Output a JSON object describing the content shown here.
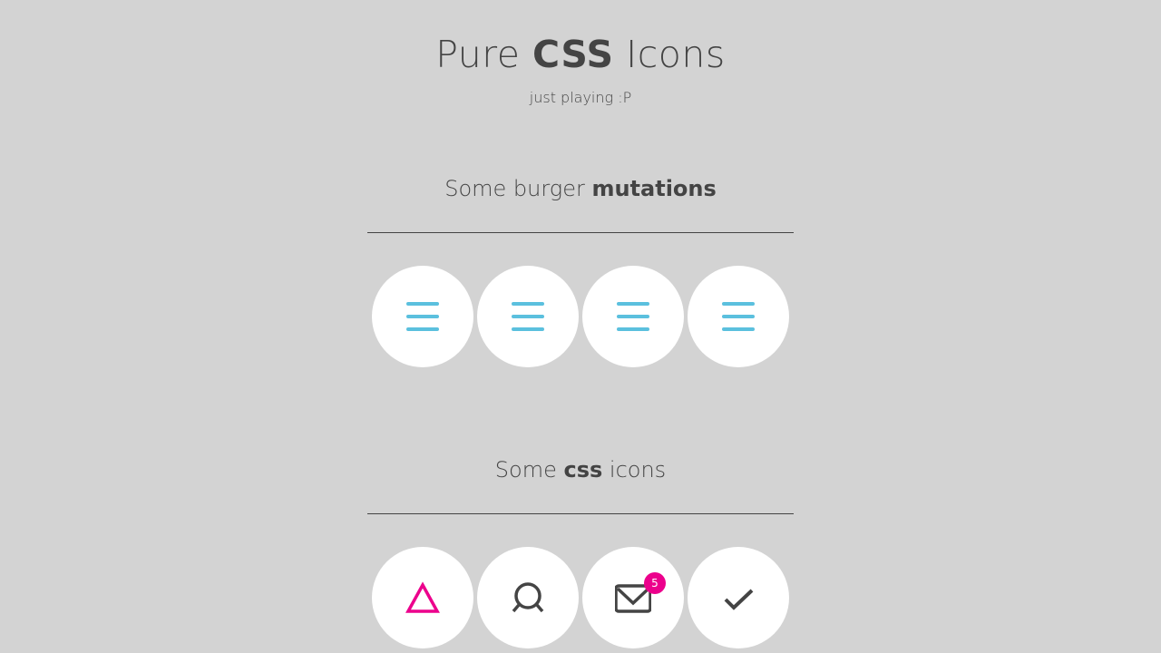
{
  "header": {
    "title_prefix": "Pure ",
    "title_bold": "CSS",
    "title_suffix": " Icons",
    "subtitle": "just playing :P"
  },
  "sections": [
    {
      "title_prefix": "Some burger ",
      "title_bold": "mutations",
      "title_suffix": "",
      "icons": [
        "burger-icon",
        "burger-icon",
        "burger-icon",
        "burger-icon"
      ],
      "icon_color": "#5bc0de"
    },
    {
      "title_prefix": "Some ",
      "title_bold": "css",
      "title_suffix": " icons",
      "icons": [
        "triangle-icon",
        "search-icon",
        "mail-icon",
        "check-icon"
      ],
      "mail_badge_count": "5",
      "accent_color": "#ec008c",
      "icon_color": "#444444"
    }
  ],
  "colors": {
    "background": "#d3d3d3",
    "circle": "#ffffff",
    "text": "#444444"
  }
}
